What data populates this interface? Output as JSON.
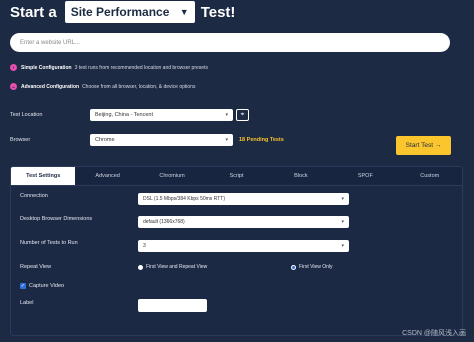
{
  "header": {
    "prefix": "Start a",
    "test_type": "Site Performance",
    "suffix": "Test!"
  },
  "url_input": {
    "placeholder": "Enter a website URL..."
  },
  "simple_config": {
    "title": "Simple Configuration",
    "desc": "3 test runs from recommended location and browser presets"
  },
  "advanced_config": {
    "title": "Advanced Configuration",
    "desc": "Choose from all browser, location, & device options"
  },
  "test_location": {
    "label": "Test Location",
    "value": "Beijing, China - Tencent"
  },
  "browser": {
    "label": "Browser",
    "value": "Chrome",
    "pending": "18 Pending Tests"
  },
  "start_button": {
    "label": "Start Test →"
  },
  "tabs": [
    {
      "label": "Test Settings"
    },
    {
      "label": "Advanced"
    },
    {
      "label": "Chromium"
    },
    {
      "label": "Script"
    },
    {
      "label": "Block"
    },
    {
      "label": "SPOF"
    },
    {
      "label": "Custom"
    }
  ],
  "settings": {
    "connection": {
      "label": "Connection",
      "value": "DSL (1.5 Mbps/384 Kbps 50ms RTT)"
    },
    "dimensions": {
      "label": "Desktop Browser Dimensions",
      "value": "default (1366x768)"
    },
    "num_tests": {
      "label": "Number of Tests to Run",
      "value": "3"
    },
    "repeat_view": {
      "label": "Repeat View",
      "option1": "First View and Repeat View",
      "option2": "First View Only",
      "selected": "First View Only"
    },
    "capture_video": {
      "label": "Capture Video",
      "checked": true
    },
    "label_field": {
      "label": "Label",
      "value": ""
    }
  },
  "watermark": "CSDN @随风浅入画",
  "colors": {
    "background": "#1c2a44",
    "accent": "#fbc52d",
    "pending": "#f7c22b",
    "config_dot": "#e94fb0",
    "radio_selected": "#2f6fd8"
  }
}
